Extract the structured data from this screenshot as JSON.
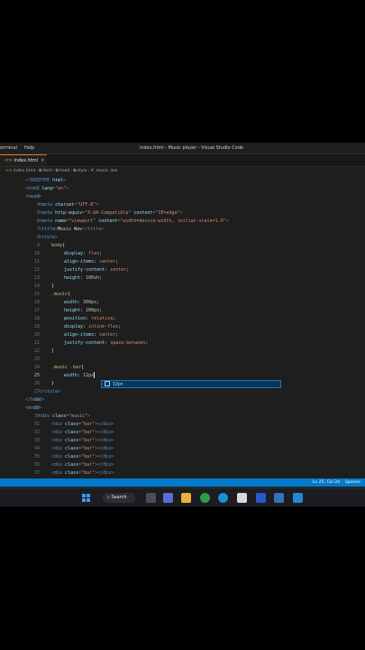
{
  "titlebar": {
    "menu": [
      "erminal",
      "Help"
    ],
    "window_title": "index.html - Music player - Visual Studio Code"
  },
  "tab": {
    "icon": "<>",
    "label": "index.html",
    "close": "×"
  },
  "breadcrumb": {
    "items": [
      "index.html",
      "html",
      "head",
      "style",
      ".music .bar"
    ],
    "icons": [
      "html-file-icon",
      "html-tag-icon",
      "html-tag-icon",
      "html-tag-icon",
      "css-selector-icon"
    ]
  },
  "editor": {
    "lines": [
      {
        "n": "1",
        "i": 28,
        "tokens": [
          [
            "t-punc",
            "<!"
          ],
          [
            "t-tag",
            "DOCTYPE"
          ],
          [
            "t-attr",
            " html"
          ],
          [
            "t-punc",
            ">"
          ]
        ]
      },
      {
        "n": "2",
        "i": 28,
        "tokens": [
          [
            "t-punc",
            "<"
          ],
          [
            "t-tag",
            "html"
          ],
          [
            "t-attr",
            " lang"
          ],
          [
            "t-punc",
            "="
          ],
          [
            "t-str",
            "\"en\""
          ],
          [
            "t-punc",
            ">"
          ]
        ]
      },
      {
        "n": "3",
        "i": 28,
        "tokens": [
          [
            "t-punc",
            "<"
          ],
          [
            "t-tag",
            "head"
          ],
          [
            "t-punc",
            ">"
          ]
        ]
      },
      {
        "n": "4",
        "i": 43,
        "tokens": [
          [
            "t-punc",
            "<"
          ],
          [
            "t-tag",
            "meta"
          ],
          [
            "t-attr",
            " charset"
          ],
          [
            "t-punc",
            "="
          ],
          [
            "t-str",
            "\"UTF-8\""
          ],
          [
            "t-punc",
            ">"
          ]
        ]
      },
      {
        "n": "5",
        "i": 43,
        "tokens": [
          [
            "t-punc",
            "<"
          ],
          [
            "t-tag",
            "meta"
          ],
          [
            "t-attr",
            " http-equiv"
          ],
          [
            "t-punc",
            "="
          ],
          [
            "t-str",
            "\"X-UA-Compatible\""
          ],
          [
            "t-attr",
            " content"
          ],
          [
            "t-punc",
            "="
          ],
          [
            "t-str",
            "\"IE=edge\""
          ],
          [
            "t-punc",
            ">"
          ]
        ]
      },
      {
        "n": "6",
        "i": 43,
        "tokens": [
          [
            "t-punc",
            "<"
          ],
          [
            "t-tag",
            "meta"
          ],
          [
            "t-attr",
            " name"
          ],
          [
            "t-punc",
            "="
          ],
          [
            "t-str",
            "\"viewport\""
          ],
          [
            "t-attr",
            " content"
          ],
          [
            "t-punc",
            "="
          ],
          [
            "t-str",
            "\"width=device-width, initial-scale=1.0\""
          ],
          [
            "t-punc",
            ">"
          ]
        ]
      },
      {
        "n": "7",
        "i": 43,
        "tokens": [
          [
            "t-punc",
            "<"
          ],
          [
            "t-tag",
            "title"
          ],
          [
            "t-punc",
            ">"
          ],
          [
            "t-text",
            "Music Wav"
          ],
          [
            "t-punc",
            "</"
          ],
          [
            "t-tag",
            "title"
          ],
          [
            "t-punc",
            ">"
          ]
        ]
      },
      {
        "n": "8",
        "i": 43,
        "tokens": [
          [
            "t-punc",
            "<"
          ],
          [
            "t-tag",
            "style"
          ],
          [
            "t-punc",
            ">"
          ]
        ]
      },
      {
        "n": "9",
        "i": 57,
        "tokens": [
          [
            "t-sel",
            "body"
          ],
          [
            "t-text",
            "{"
          ]
        ]
      },
      {
        "n": "10",
        "i": 71,
        "tokens": [
          [
            "t-prop",
            "display"
          ],
          [
            "t-text",
            ": "
          ],
          [
            "t-val",
            "flex"
          ],
          [
            "t-text",
            ";"
          ]
        ]
      },
      {
        "n": "11",
        "i": 71,
        "tokens": [
          [
            "t-prop",
            "align-items"
          ],
          [
            "t-text",
            ": "
          ],
          [
            "t-val",
            "center"
          ],
          [
            "t-text",
            ";"
          ]
        ]
      },
      {
        "n": "12",
        "i": 71,
        "tokens": [
          [
            "t-prop",
            "justify-content"
          ],
          [
            "t-text",
            ": "
          ],
          [
            "t-val",
            "center"
          ],
          [
            "t-text",
            ";"
          ]
        ]
      },
      {
        "n": "13",
        "i": 71,
        "tokens": [
          [
            "t-prop",
            "height"
          ],
          [
            "t-text",
            ": "
          ],
          [
            "t-num",
            "100vh"
          ],
          [
            "t-text",
            ";"
          ]
        ]
      },
      {
        "n": "14",
        "i": 57,
        "tokens": [
          [
            "t-text",
            "}"
          ]
        ]
      },
      {
        "n": "15",
        "i": 57,
        "tokens": [
          [
            "t-sel",
            ".music"
          ],
          [
            "t-text",
            "{"
          ]
        ]
      },
      {
        "n": "16",
        "i": 71,
        "tokens": [
          [
            "t-prop",
            "width"
          ],
          [
            "t-text",
            ": "
          ],
          [
            "t-num",
            "300px"
          ],
          [
            "t-text",
            ";"
          ]
        ]
      },
      {
        "n": "17",
        "i": 71,
        "tokens": [
          [
            "t-prop",
            "height"
          ],
          [
            "t-text",
            ": "
          ],
          [
            "t-num",
            "200px"
          ],
          [
            "t-text",
            ";"
          ]
        ]
      },
      {
        "n": "18",
        "i": 71,
        "tokens": [
          [
            "t-prop",
            "position"
          ],
          [
            "t-text",
            ": "
          ],
          [
            "t-val",
            "relative"
          ],
          [
            "t-text",
            ";"
          ]
        ]
      },
      {
        "n": "19",
        "i": 71,
        "tokens": [
          [
            "t-prop",
            "display"
          ],
          [
            "t-text",
            ": "
          ],
          [
            "t-val",
            "inline-flex"
          ],
          [
            "t-text",
            ";"
          ]
        ]
      },
      {
        "n": "20",
        "i": 71,
        "tokens": [
          [
            "t-prop",
            "align-items"
          ],
          [
            "t-text",
            ": "
          ],
          [
            "t-val",
            "center"
          ],
          [
            "t-text",
            ";"
          ]
        ]
      },
      {
        "n": "21",
        "i": 71,
        "tokens": [
          [
            "t-prop",
            "justify-content"
          ],
          [
            "t-text",
            ": "
          ],
          [
            "t-val",
            "space-between"
          ],
          [
            "t-text",
            ";"
          ]
        ]
      },
      {
        "n": "22",
        "i": 57,
        "tokens": [
          [
            "t-text",
            "}"
          ]
        ]
      },
      {
        "n": "23",
        "i": 57,
        "tokens": []
      },
      {
        "n": "24",
        "i": 57,
        "tokens": [
          [
            "t-sel",
            ".music .bar"
          ],
          [
            "t-text",
            "{"
          ]
        ]
      },
      {
        "n": "25",
        "i": 71,
        "active": true,
        "cursor": true,
        "tokens": [
          [
            "t-prop",
            "width"
          ],
          [
            "t-text",
            ": "
          ],
          [
            "t-num",
            "12px"
          ]
        ]
      },
      {
        "n": "26",
        "i": 57,
        "tokens": [
          [
            "t-text",
            "}"
          ]
        ]
      },
      {
        "n": "27",
        "i": 43,
        "tokens": [
          [
            "t-punc",
            "</"
          ],
          [
            "t-tag",
            "style"
          ],
          [
            "t-punc",
            ">"
          ]
        ]
      },
      {
        "n": "28",
        "i": 28,
        "tokens": [
          [
            "t-punc",
            "</"
          ],
          [
            "t-tag",
            "head"
          ],
          [
            "t-punc",
            ">"
          ]
        ]
      },
      {
        "n": "29",
        "i": 28,
        "tokens": [
          [
            "t-punc",
            "<"
          ],
          [
            "t-tag",
            "body"
          ],
          [
            "t-punc",
            ">"
          ]
        ]
      },
      {
        "n": "30",
        "i": 43,
        "tokens": [
          [
            "t-punc",
            "<"
          ],
          [
            "t-tag",
            "div"
          ],
          [
            "t-attr",
            " class"
          ],
          [
            "t-punc",
            "="
          ],
          [
            "t-str",
            "\"music\""
          ],
          [
            "t-punc",
            ">"
          ]
        ]
      },
      {
        "n": "31",
        "i": 57,
        "tokens": [
          [
            "t-punc",
            "<"
          ],
          [
            "t-tag",
            "div"
          ],
          [
            "t-attr",
            " class"
          ],
          [
            "t-punc",
            "="
          ],
          [
            "t-str",
            "\"bar\""
          ],
          [
            "t-punc",
            "></"
          ],
          [
            "t-tag",
            "div"
          ],
          [
            "t-punc",
            ">"
          ]
        ]
      },
      {
        "n": "32",
        "i": 57,
        "tokens": [
          [
            "t-punc",
            "<"
          ],
          [
            "t-tag",
            "div"
          ],
          [
            "t-attr",
            " class"
          ],
          [
            "t-punc",
            "="
          ],
          [
            "t-str",
            "\"bar\""
          ],
          [
            "t-punc",
            "></"
          ],
          [
            "t-tag",
            "div"
          ],
          [
            "t-punc",
            ">"
          ]
        ]
      },
      {
        "n": "33",
        "i": 57,
        "tokens": [
          [
            "t-punc",
            "<"
          ],
          [
            "t-tag",
            "div"
          ],
          [
            "t-attr",
            " class"
          ],
          [
            "t-punc",
            "="
          ],
          [
            "t-str",
            "\"bar\""
          ],
          [
            "t-punc",
            "></"
          ],
          [
            "t-tag",
            "div"
          ],
          [
            "t-punc",
            ">"
          ]
        ]
      },
      {
        "n": "34",
        "i": 57,
        "tokens": [
          [
            "t-punc",
            "<"
          ],
          [
            "t-tag",
            "div"
          ],
          [
            "t-attr",
            " class"
          ],
          [
            "t-punc",
            "="
          ],
          [
            "t-str",
            "\"bar\""
          ],
          [
            "t-punc",
            "></"
          ],
          [
            "t-tag",
            "div"
          ],
          [
            "t-punc",
            ">"
          ]
        ]
      },
      {
        "n": "35",
        "i": 57,
        "tokens": [
          [
            "t-punc",
            "<"
          ],
          [
            "t-tag",
            "div"
          ],
          [
            "t-attr",
            " class"
          ],
          [
            "t-punc",
            "="
          ],
          [
            "t-str",
            "\"bar\""
          ],
          [
            "t-punc",
            "></"
          ],
          [
            "t-tag",
            "div"
          ],
          [
            "t-punc",
            ">"
          ]
        ]
      },
      {
        "n": "36",
        "i": 57,
        "tokens": [
          [
            "t-punc",
            "<"
          ],
          [
            "t-tag",
            "div"
          ],
          [
            "t-attr",
            " class"
          ],
          [
            "t-punc",
            "="
          ],
          [
            "t-str",
            "\"bar\""
          ],
          [
            "t-punc",
            "></"
          ],
          [
            "t-tag",
            "div"
          ],
          [
            "t-punc",
            ">"
          ]
        ]
      },
      {
        "n": "37",
        "i": 57,
        "tokens": [
          [
            "t-punc",
            "<"
          ],
          [
            "t-tag",
            "div"
          ],
          [
            "t-attr",
            " class"
          ],
          [
            "t-punc",
            "="
          ],
          [
            "t-str",
            "\"bar\""
          ],
          [
            "t-punc",
            "></"
          ],
          [
            "t-tag",
            "div"
          ],
          [
            "t-punc",
            ">"
          ]
        ]
      }
    ]
  },
  "suggestion": {
    "label": "12px"
  },
  "statusbar": {
    "position": "Ln 25, Col 24",
    "spaces": "Spaces:"
  },
  "taskbar": {
    "search_label": "Search"
  },
  "colors": {
    "accent": "#007acc",
    "tab_border": "#d97a2a"
  }
}
